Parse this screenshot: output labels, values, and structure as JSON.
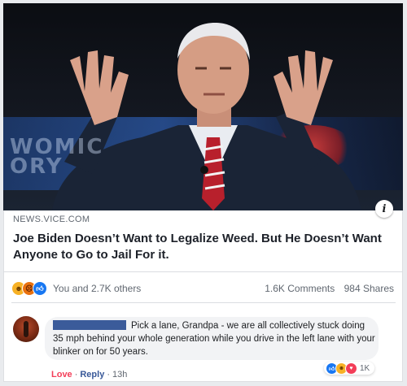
{
  "post": {
    "source": "NEWS.VICE.COM",
    "headline": "Joe Biden Doesn’t Want to Legalize Weed. But He Doesn’t Want Anyone to Go to Jail For it.",
    "reactions": {
      "icons": [
        "haha-reaction-icon",
        "angry-reaction-icon",
        "like-reaction-icon"
      ],
      "summary": "You and 2.7K others"
    },
    "comments_count": "1.6K Comments",
    "shares_count": "984 Shares"
  },
  "comment": {
    "text": "Pick a lane, Grandpa - we are all collectively stuck doing 35 mph behind your whole generation while you drive in the left lane with your blinker on for 50 years.",
    "reaction_count": "1K",
    "reaction_icons": [
      "like-reaction-icon",
      "haha-reaction-icon",
      "love-reaction-icon"
    ],
    "actions": {
      "love": "Love",
      "reply": "Reply",
      "time": "13h"
    }
  },
  "colors": {
    "like": "#1877f2",
    "love": "#f33e58",
    "link": "#385898",
    "redaction": "#3b5b9a"
  }
}
